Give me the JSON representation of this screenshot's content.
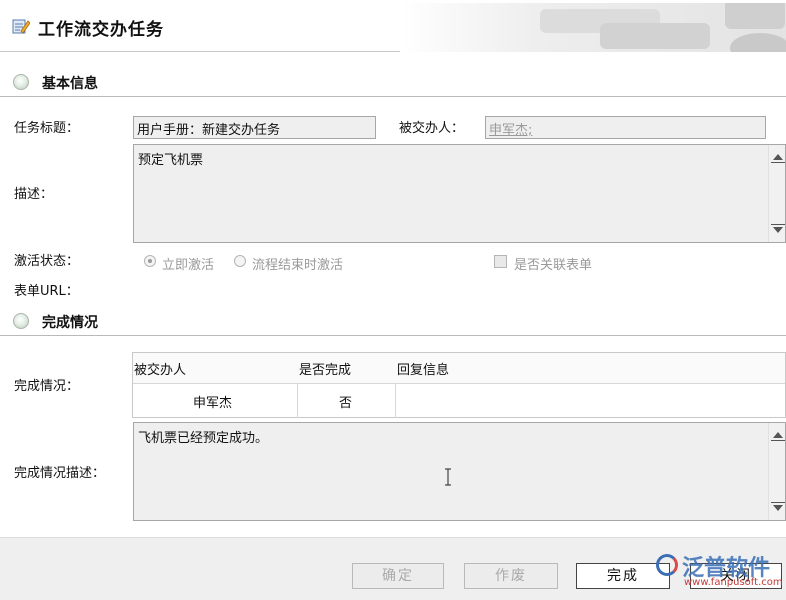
{
  "header": {
    "title": "工作流交办任务",
    "icon": "edit-document-icon"
  },
  "sections": {
    "basic_info": "基本信息",
    "completion": "完成情况"
  },
  "form": {
    "task_title_label": "任务标题：",
    "task_title_value": "用户手册：新建交办任务",
    "assignee_label": "被交办人：",
    "assignee_value": "申军杰;",
    "description_label": "描述：",
    "description_value": "预定飞机票",
    "activation_label": "激活状态：",
    "activation_options": [
      "立即激活",
      "流程结束时激活"
    ],
    "activation_selected": "立即激活",
    "related_form_label": "是否关联表单",
    "related_form_checked": false,
    "form_url_label": "表单URL："
  },
  "completion": {
    "status_label": "完成情况：",
    "columns": [
      "被交办人",
      "是否完成",
      "回复信息"
    ],
    "rows": [
      {
        "assignee": "申军杰",
        "done": "否",
        "reply": ""
      }
    ],
    "description_label": "完成情况描述：",
    "description_value": "飞机票已经预定成功。"
  },
  "footer": {
    "confirm": "确定",
    "void": "作废",
    "complete": "完成",
    "close": "关闭"
  },
  "watermark": {
    "text": "泛普软件",
    "url": "www.fanpusoft.com"
  },
  "colors": {
    "disabled_text": "#9a9a9a",
    "field_bg": "#efefef",
    "watermark_blue": "#3a6fb5"
  }
}
